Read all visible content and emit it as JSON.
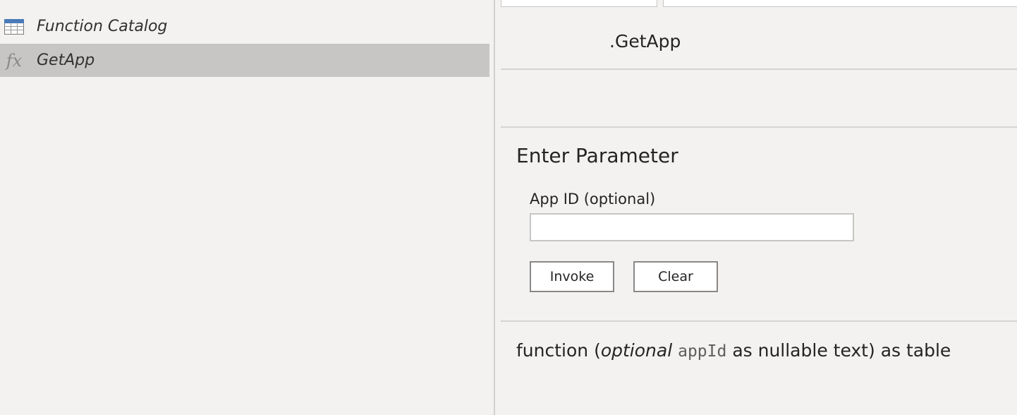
{
  "queries": {
    "items": [
      {
        "label": "Function Catalog",
        "icon": "table-icon",
        "selected": false
      },
      {
        "label": "GetApp",
        "icon": "fx-icon",
        "icon_glyph": "fx",
        "selected": true
      }
    ]
  },
  "function_panel": {
    "name": ".GetApp",
    "section_title": "Enter Parameter",
    "parameter": {
      "label": "App ID (optional)",
      "value": "",
      "placeholder": ""
    },
    "invoke_label": "Invoke",
    "clear_label": "Clear",
    "signature": {
      "prefix": "function (",
      "optional_keyword": "optional",
      "param_name": "appId",
      "suffix": "as nullable text) as table"
    }
  },
  "colors": {
    "background": "#f3f2f1",
    "selected_row": "#c8c6c4",
    "table_icon_header": "#4a7ab8"
  }
}
